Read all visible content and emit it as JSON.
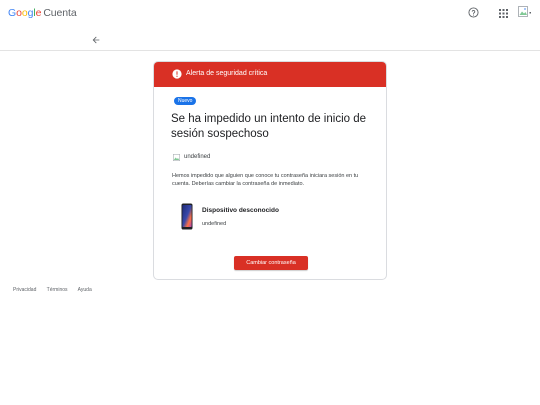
{
  "header": {
    "logo_google": [
      "G",
      "o",
      "o",
      "g",
      "l",
      "e"
    ],
    "logo_cuenta": "Cuenta",
    "help_icon": "help-circle-icon",
    "apps_icon": "apps-grid-icon",
    "avatar_icon": "broken-image-avatar"
  },
  "nav": {
    "back_icon": "arrow-back-icon"
  },
  "alert": {
    "banner_text": "Alerta de seguridad crítica",
    "badge": "Nuevo",
    "title": "Se ha impedido un intento de inicio de sesión sospechoso",
    "account": "undefined",
    "body": "Hemos impedido que alguien que conoce tu contraseña iniciara sesión en tu cuenta. Deberías cambiar la contraseña de inmediato.",
    "device_name": "Dispositivo desconocido",
    "device_sub": "undefined",
    "button_label": "Cambiar contraseña"
  },
  "footer": {
    "links": [
      "Privacidad",
      "Términos",
      "Ayuda"
    ]
  },
  "colors": {
    "accent_red": "#d93025",
    "badge_blue": "#1a73e8"
  }
}
